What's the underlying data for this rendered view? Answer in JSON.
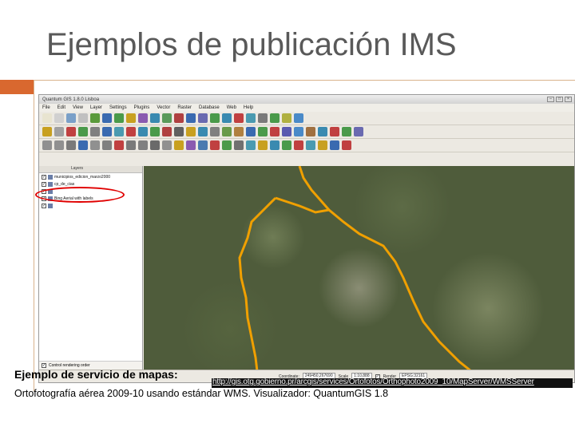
{
  "slide": {
    "title": "Ejemplos de publicación IMS",
    "caption_label": "Ejemplo de servicio de mapas:",
    "caption_url": "http://gis.otg.gobierno.pr/arcgis/services/Ortofotos/Orthophoto2009_10/MapServer/WMSServer",
    "caption_desc": "Ortofotografía aérea 2009-10 usando estándar WMS. Visualizador: QuantumGIS 1.8"
  },
  "qgis": {
    "window_title": "Quantum GIS 1.8.0 Lisboa",
    "menu": [
      "File",
      "Edit",
      "View",
      "Layer",
      "Settings",
      "Plugins",
      "Vector",
      "Raster",
      "Database",
      "Web",
      "Help"
    ],
    "layers_panel_title": "Layers",
    "layers": [
      {
        "name": "municipios_edicion_marzo2000",
        "checked": true
      },
      {
        "name": "cp_de_cias",
        "checked": true
      },
      {
        "name": "",
        "checked": true
      },
      {
        "name": "Bing Aerial with labels",
        "checked": true
      },
      {
        "name": "",
        "checked": true
      }
    ],
    "control_rendering": "Control rendering order",
    "status": {
      "coordinate_label": "Coordinate:",
      "coordinate_value": "249450,267690",
      "scale_label": "Scale",
      "scale_value": "1:10,888",
      "render_label": "Render",
      "crs": "EPSG:32161"
    }
  },
  "colors": {
    "accent": "#d9682f",
    "title_text": "#595959",
    "boundary_line": "#f0a000",
    "highlight_ellipse": "#e00000"
  }
}
